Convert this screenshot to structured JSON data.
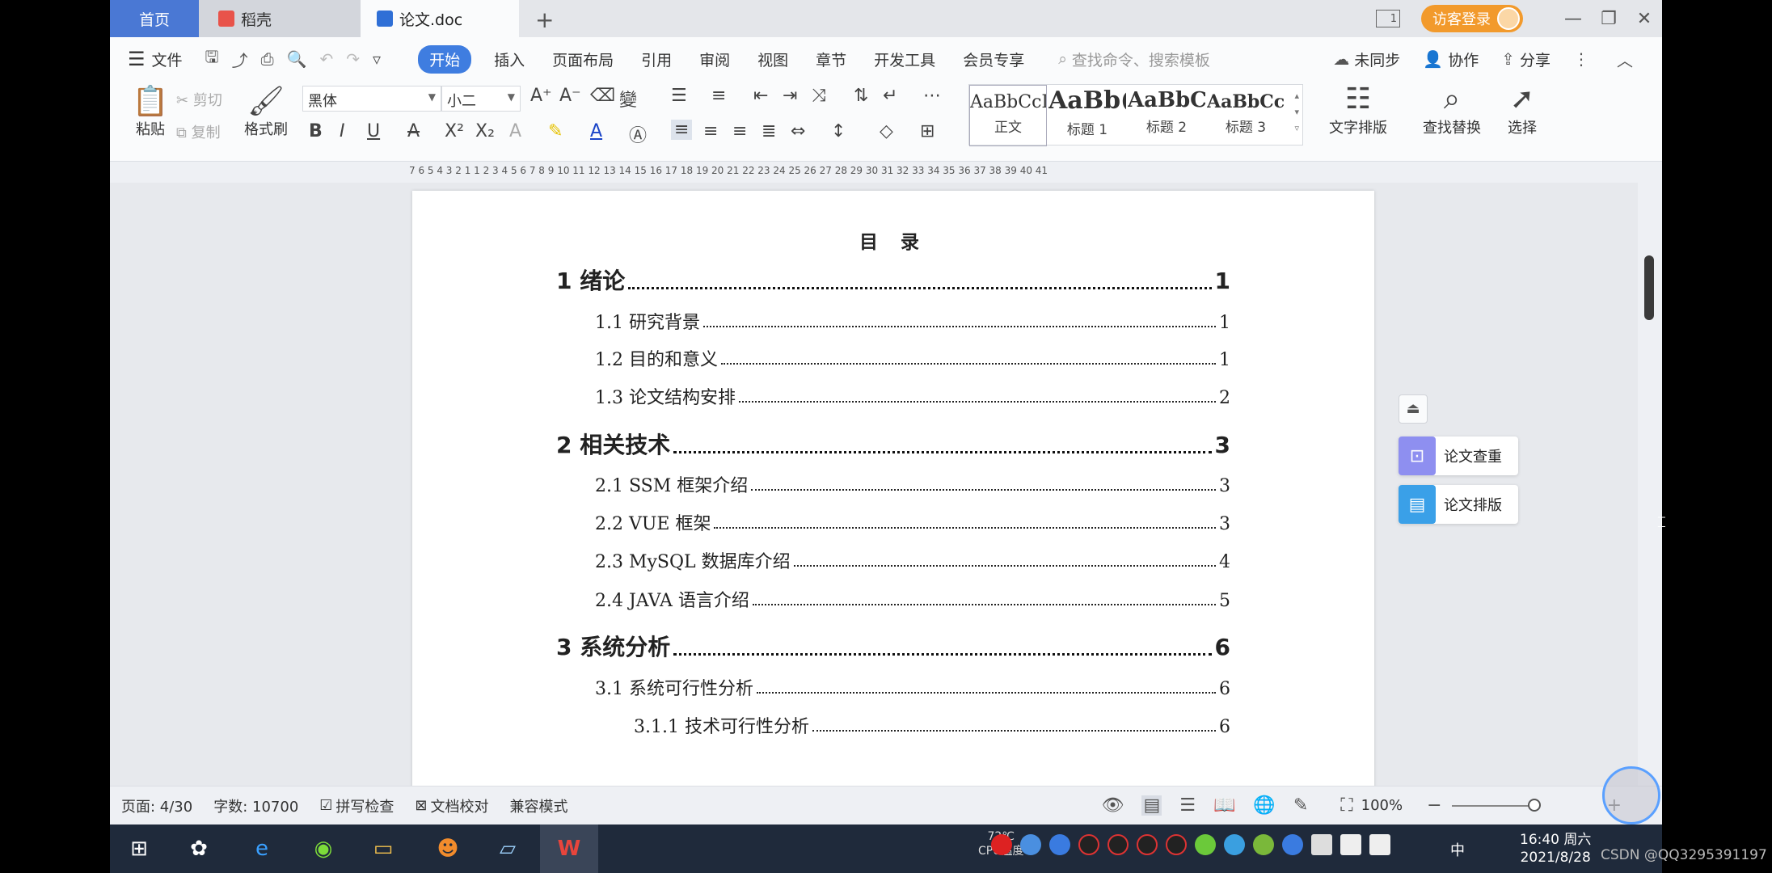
{
  "tabs": {
    "home": "首页",
    "daoke": "稻壳",
    "doc": "论文.doc",
    "add": "+"
  },
  "titlebar": {
    "page_indicator": "1",
    "login": "访客登录"
  },
  "menu": {
    "file": "文件",
    "items": [
      "开始",
      "插入",
      "页面布局",
      "引用",
      "审阅",
      "视图",
      "章节",
      "开发工具",
      "会员专享"
    ],
    "search_placeholder": "查找命令、搜索模板",
    "sync": "未同步",
    "collab": "协作",
    "share": "分享"
  },
  "ribbon": {
    "paste": "粘贴",
    "cut": "剪切",
    "copy": "复制",
    "format_painter": "格式刷",
    "font": "黑体",
    "size": "小二",
    "styles": [
      {
        "preview": "AaBbCcI",
        "label": "正文"
      },
      {
        "preview": "AaBb(",
        "label": "标题 1"
      },
      {
        "preview": "AaBbC",
        "label": "标题 2"
      },
      {
        "preview": "AaBbCcl",
        "label": "标题 3"
      }
    ],
    "text_layout": "文字排版",
    "find_replace": "查找替换",
    "select": "选择"
  },
  "ruler": "7 6 5 4 3 2 1 1 2 3 4 5 6 7 8 9 10 11 12 13 14 15 16 17 18 19 20 21 22 23 24 25 26 27 28 29 30 31 32 33 34 35 36 37 38 39 40 41",
  "document": {
    "title": "目 录",
    "toc": [
      {
        "level": 1,
        "label": "1  绪论",
        "page": "1"
      },
      {
        "level": 2,
        "label": "1.1  研究背景",
        "page": "1"
      },
      {
        "level": 2,
        "label": "1.2 目的和意义",
        "page": "1"
      },
      {
        "level": 2,
        "label": "1.3  论文结构安排",
        "page": "2"
      },
      {
        "level": 1,
        "label": "2  相关技术",
        "page": "3"
      },
      {
        "level": 2,
        "label": "2.1 SSM 框架介绍",
        "page": "3"
      },
      {
        "level": 2,
        "label": "2.2 VUE 框架",
        "page": "3"
      },
      {
        "level": 2,
        "label": "2.3 MySQL 数据库介绍",
        "page": "4"
      },
      {
        "level": 2,
        "label": "2.4 JAVA 语言介绍",
        "page": "5"
      },
      {
        "level": 1,
        "label": "3  系统分析",
        "page": "6"
      },
      {
        "level": 2,
        "label": "3.1 系统可行性分析",
        "page": "6"
      },
      {
        "level": 3,
        "label": "3.1.1  技术可行性分析",
        "page": "6"
      }
    ]
  },
  "side": {
    "check": "论文查重",
    "layout": "论文排版"
  },
  "status": {
    "page": "页面: 4/30",
    "words": "字数: 10700",
    "spell": "拼写检查",
    "proof": "文档校对",
    "compat": "兼容模式",
    "zoom": "100%"
  },
  "taskbar": {
    "temp": "72℃",
    "temp_label": "CPU温度",
    "lang": "中",
    "time": "16:40 周六",
    "date": "2021/8/28"
  },
  "watermark": "CSDN @QQ3295391197",
  "colors": {
    "accent": "#3f7de0",
    "home_tab": "#4a78d4",
    "login": "#f29a2c",
    "side_check": "#8e8ff0",
    "side_layout": "#3aa0e8"
  }
}
